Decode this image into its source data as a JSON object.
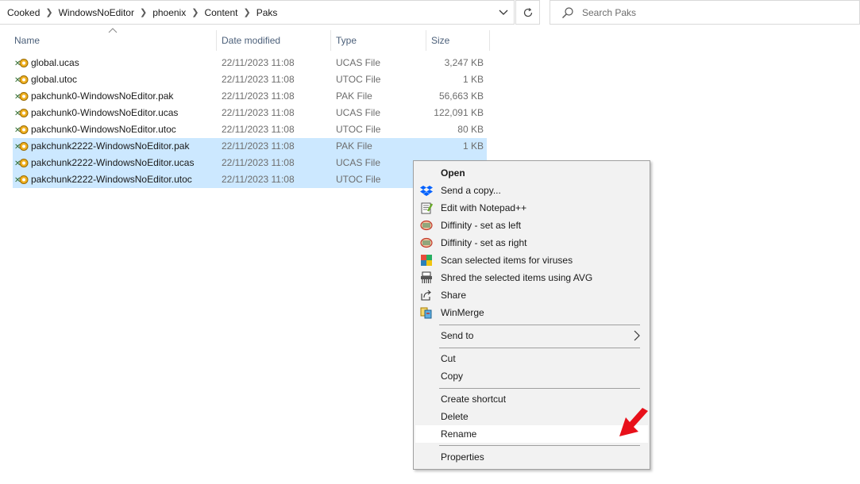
{
  "address": {
    "crumbs": [
      "Cooked",
      "WindowsNoEditor",
      "phoenix",
      "Content",
      "Paks"
    ]
  },
  "search": {
    "placeholder": "Search Paks"
  },
  "columns": {
    "name": "Name",
    "date": "Date modified",
    "type": "Type",
    "size": "Size"
  },
  "files": [
    {
      "name": "global.ucas",
      "date": "22/11/2023 11:08",
      "type": "UCAS File",
      "size": "3,247 KB",
      "selected": false
    },
    {
      "name": "global.utoc",
      "date": "22/11/2023 11:08",
      "type": "UTOC File",
      "size": "1 KB",
      "selected": false
    },
    {
      "name": "pakchunk0-WindowsNoEditor.pak",
      "date": "22/11/2023 11:08",
      "type": "PAK File",
      "size": "56,663 KB",
      "selected": false
    },
    {
      "name": "pakchunk0-WindowsNoEditor.ucas",
      "date": "22/11/2023 11:08",
      "type": "UCAS File",
      "size": "122,091 KB",
      "selected": false
    },
    {
      "name": "pakchunk0-WindowsNoEditor.utoc",
      "date": "22/11/2023 11:08",
      "type": "UTOC File",
      "size": "80 KB",
      "selected": false
    },
    {
      "name": "pakchunk2222-WindowsNoEditor.pak",
      "date": "22/11/2023 11:08",
      "type": "PAK File",
      "size": "1 KB",
      "selected": true
    },
    {
      "name": "pakchunk2222-WindowsNoEditor.ucas",
      "date": "22/11/2023 11:08",
      "type": "UCAS File",
      "size": "",
      "selected": true
    },
    {
      "name": "pakchunk2222-WindowsNoEditor.utoc",
      "date": "22/11/2023 11:08",
      "type": "UTOC File",
      "size": "",
      "selected": true
    }
  ],
  "menu": {
    "open": "Open",
    "send_copy": "Send a copy...",
    "notepad": "Edit with Notepad++",
    "diff_left": "Diffinity - set as left",
    "diff_right": "Diffinity - set as right",
    "scan": "Scan selected items for viruses",
    "shred": "Shred the selected items using AVG",
    "share": "Share",
    "winmerge": "WinMerge",
    "send_to": "Send to",
    "cut": "Cut",
    "copy": "Copy",
    "create_shortcut": "Create shortcut",
    "delete": "Delete",
    "rename": "Rename",
    "properties": "Properties"
  },
  "colors": {
    "selection": "#cce8ff",
    "header_text": "#4c607a",
    "arrow": "#e8101a"
  }
}
